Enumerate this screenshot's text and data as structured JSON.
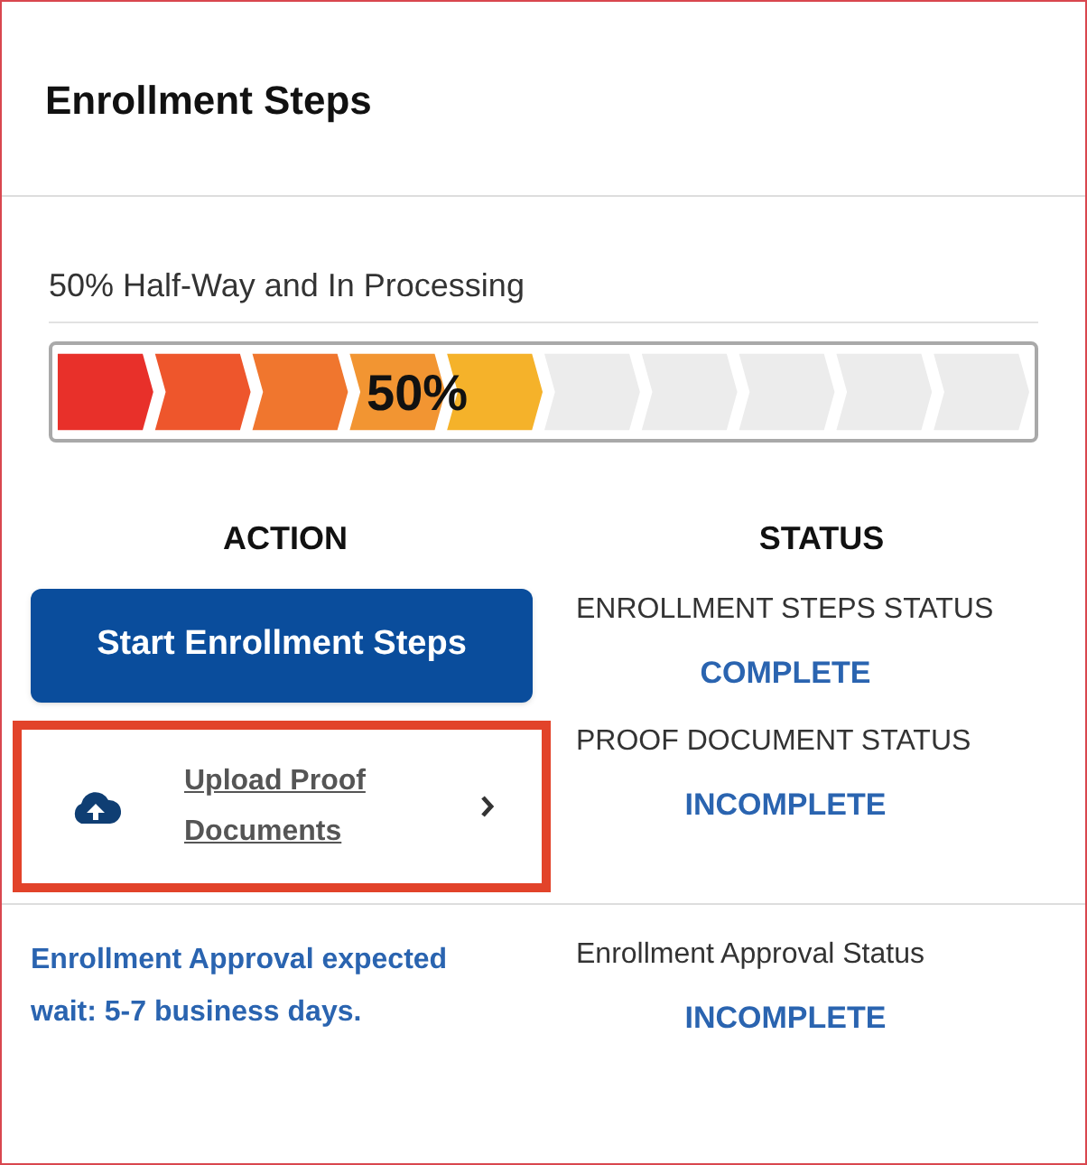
{
  "title": "Enrollment Steps",
  "progress": {
    "caption": "50% Half-Way and In Processing",
    "level": 0.5,
    "label": "50%"
  },
  "columns": {
    "action": "ACTION",
    "status": "STATUS"
  },
  "rows": [
    {
      "kind": "button",
      "action": "Start Enrollment Steps",
      "status_label": "ENROLLMENT STEPS STATUS",
      "status": "COMPLETE",
      "highlighted": false
    },
    {
      "kind": "link",
      "action": "Upload Proof Documents",
      "status_label": "PROOF DOCUMENT STATUS",
      "status": "INCOMPLETE",
      "highlighted": true
    },
    {
      "kind": "note",
      "action": "Enrollment Approval expected wait: 5-7 business days.",
      "status_label": "Enrollment Approval Status",
      "status": "INCOMPLETE",
      "highlighted": false
    }
  ]
}
